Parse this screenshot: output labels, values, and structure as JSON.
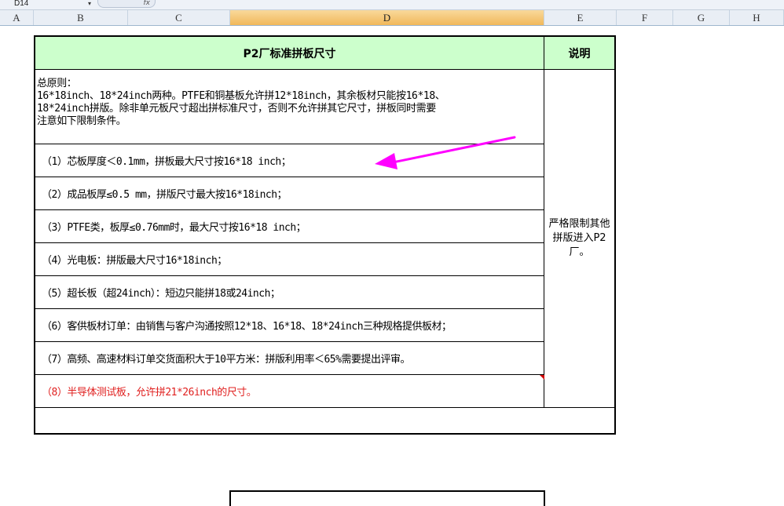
{
  "formula_bar": {
    "name_box": "D14",
    "fx_label": "fx"
  },
  "columns": [
    "A",
    "B",
    "C",
    "D",
    "E",
    "F",
    "G",
    "H"
  ],
  "selected_column": "D",
  "table": {
    "header_left": "P2厂标准拼板尺寸",
    "header_right": "说明",
    "principle_lines": [
      "总原则：",
      "16*18inch、18*24inch两种。PTFE和铜基板允许拼12*18inch，其余板材只能按16*18、",
      "18*24inch拼版。除非单元板尺寸超出拼标准尺寸，否则不允许拼其它尺寸，拼板同时需要",
      "注意如下限制条件。"
    ],
    "rules": [
      "（1）芯板厚度＜0.1mm，拼板最大尺寸按16*18 inch；",
      "（2）成品板厚≤0.5 mm，拼版尺寸最大按16*18inch；",
      "（3）PTFE类，板厚≤0.76mm时，最大尺寸按16*18 inch；",
      "（4）光电板：拼版最大尺寸16*18inch；",
      "（5）超长板（超24inch）：短边只能拼18或24inch；",
      "（6）客供板材订单：由销售与客户沟通按照12*18、16*18、18*24inch三种规格提供板材；",
      "（7）高频、高速材料订单交货面积大于10平方米：拼版利用率＜65%需要提出评审。",
      "（8）半导体测试板，允许拼21*26inch的尺寸。"
    ],
    "note": "严格限制其他拼版进入P2厂。"
  },
  "colors": {
    "header_bg": "#ccffcc",
    "arrow": "#ff00ff",
    "red_text": "#e0201f",
    "selected_col": "#f1b85a"
  }
}
